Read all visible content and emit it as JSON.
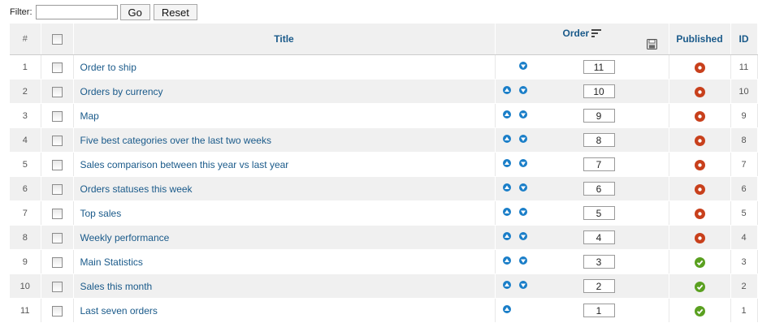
{
  "filter": {
    "label": "Filter:",
    "value": "",
    "go_label": "Go",
    "reset_label": "Reset"
  },
  "columns": {
    "num": "#",
    "title": "Title",
    "order": "Order",
    "published": "Published",
    "id": "ID"
  },
  "colors": {
    "link": "#1a5a8a",
    "arrow": "#1a7ec8",
    "unpublished": "#c8401c",
    "published": "#5aa020"
  },
  "rows": [
    {
      "num": "1",
      "title": "Order to ship",
      "up": false,
      "down": true,
      "order": "11",
      "published": false,
      "id": "11"
    },
    {
      "num": "2",
      "title": "Orders by currency",
      "up": true,
      "down": true,
      "order": "10",
      "published": false,
      "id": "10"
    },
    {
      "num": "3",
      "title": "Map",
      "up": true,
      "down": true,
      "order": "9",
      "published": false,
      "id": "9"
    },
    {
      "num": "4",
      "title": "Five best categories over the last two weeks",
      "up": true,
      "down": true,
      "order": "8",
      "published": false,
      "id": "8"
    },
    {
      "num": "5",
      "title": "Sales comparison between this year vs last year",
      "up": true,
      "down": true,
      "order": "7",
      "published": false,
      "id": "7"
    },
    {
      "num": "6",
      "title": "Orders statuses this week",
      "up": true,
      "down": true,
      "order": "6",
      "published": false,
      "id": "6"
    },
    {
      "num": "7",
      "title": "Top sales",
      "up": true,
      "down": true,
      "order": "5",
      "published": false,
      "id": "5"
    },
    {
      "num": "8",
      "title": "Weekly performance",
      "up": true,
      "down": true,
      "order": "4",
      "published": false,
      "id": "4"
    },
    {
      "num": "9",
      "title": "Main Statistics",
      "up": true,
      "down": true,
      "order": "3",
      "published": true,
      "id": "3"
    },
    {
      "num": "10",
      "title": "Sales this month",
      "up": true,
      "down": true,
      "order": "2",
      "published": true,
      "id": "2"
    },
    {
      "num": "11",
      "title": "Last seven orders",
      "up": true,
      "down": false,
      "order": "1",
      "published": true,
      "id": "1"
    }
  ]
}
